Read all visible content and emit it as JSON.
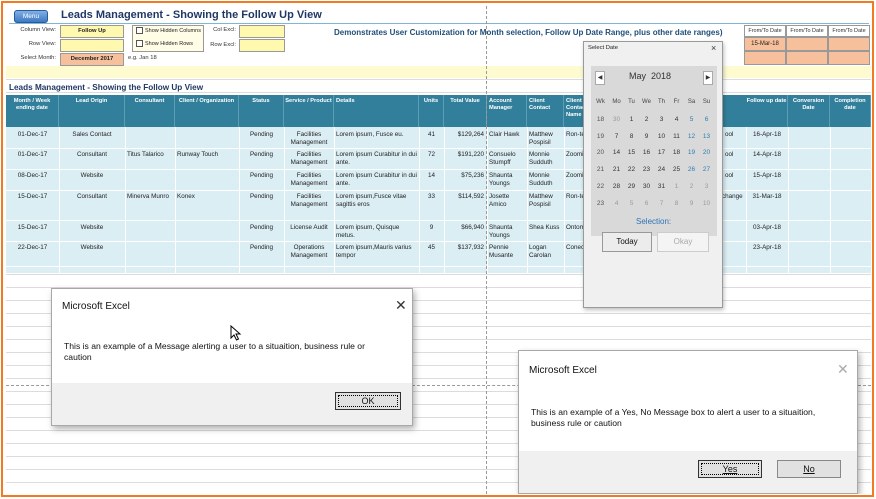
{
  "header": {
    "menu_label": "Menu",
    "title": "Leads Management - Showing the Follow Up View",
    "demo_text": "Demonstrates User Customization for Month selection, Follow Up Date Range, plus other date ranges)"
  },
  "controls": {
    "column_view_label": "Column View:",
    "column_view_value": "Follow Up",
    "row_view_label": "Row View:",
    "row_view_value": "",
    "select_month_label": "Select Month:",
    "select_month_value": "December 2017",
    "month_hint": "e.g. Jan 18",
    "show_hidden_columns": "Show Hidden Columns",
    "show_hidden_rows": "Show Hidden Rows",
    "col_excl_label": "Col Excl:",
    "row_excl_label": "Row Excl:"
  },
  "from_to": {
    "headers": [
      "From/To Date",
      "From/To Date",
      "From/To Date"
    ],
    "first_value": "15-Mar-18"
  },
  "subtitle": "Leads Management - Showing the Follow Up View",
  "table": {
    "columns": [
      "Month / Week ending date",
      "Lead Origin",
      "Consultant",
      "Client / Organization",
      "Status",
      "Service / Product",
      "Details",
      "Units",
      "Total Value",
      "Account Manager",
      "Client Contact",
      "Client Contact Name",
      "Follow up date",
      "Conversion Date",
      "Completion date"
    ],
    "rows": [
      {
        "date": "01-Dec-17",
        "origin": "Sales Contact",
        "consultant": "",
        "client": "",
        "status": "Pending",
        "service": "Facilities Management",
        "details": "Lorem ipsum, Fusce eu.",
        "units": "41",
        "value": "$129,264",
        "am": "Clair Hawk",
        "contact": "Matthew Pospisil",
        "name": "Ron-te",
        "tail": "ool",
        "follow": "16-Apr-18"
      },
      {
        "date": "01-Dec-17",
        "origin": "Consultant",
        "consultant": "Titus Talarico",
        "client": "Runway Touch",
        "status": "Pending",
        "service": "Facilities Management",
        "details": "Lorem ipsum Curabitur in dui ante.",
        "units": "72",
        "value": "$191,220",
        "am": "Consuelo Stumpff",
        "contact": "Monnie Sudduth",
        "name": "Zoomi",
        "tail": "ool",
        "follow": "14-Apr-18"
      },
      {
        "date": "08-Dec-17",
        "origin": "Website",
        "consultant": "",
        "client": "",
        "status": "Pending",
        "service": "Facilities Management",
        "details": "Lorem ipsum Curabitur in dui ante.",
        "units": "14",
        "value": "$75,236",
        "am": "Shaunta Youngs",
        "contact": "Monnie Sudduth",
        "name": "Zoomi",
        "tail": "ool",
        "follow": "15-Apr-18"
      },
      {
        "date": "15-Dec-17",
        "origin": "Consultant",
        "consultant": "Minerva Munro",
        "client": "Konex",
        "status": "Pending",
        "service": "Facilities Management",
        "details": "Lorem ipsum,Fusce vitae sagittis eros",
        "units": "33",
        "value": "$114,592",
        "am": "Josette Amico",
        "contact": "Matthew Pospisil",
        "name": "Ron-te",
        "tail": "change",
        "follow": "31-Mar-18"
      },
      {
        "date": "15-Dec-17",
        "origin": "Website",
        "consultant": "",
        "client": "",
        "status": "Pending",
        "service": "License Audit",
        "details": "Lorem ipsum, Quisque metus.",
        "units": "9",
        "value": "$66,940",
        "am": "Shaunta Youngs",
        "contact": "Shea Kuss",
        "name": "Ontom",
        "tail": "",
        "follow": "03-Apr-18"
      },
      {
        "date": "22-Dec-17",
        "origin": "Website",
        "consultant": "",
        "client": "",
        "status": "Pending",
        "service": "Operations Management",
        "details": "Lorem ipsum,Mauris varius tempor",
        "units": "45",
        "value": "$137,932",
        "am": "Pennie Musante",
        "contact": "Logan Carolan",
        "name": "Conec",
        "tail": "",
        "follow": "23-Apr-18"
      }
    ]
  },
  "date_picker": {
    "title": "Select Date",
    "close": "×",
    "month": "May",
    "year": "2018",
    "prev": "◀",
    "next": "▶",
    "weekday_headers": [
      "Wk",
      "Mo",
      "Tu",
      "We",
      "Th",
      "Fr",
      "Sa",
      "Su"
    ],
    "weeks": [
      [
        "18",
        "30",
        "1",
        "2",
        "3",
        "4",
        "5",
        "6"
      ],
      [
        "19",
        "7",
        "8",
        "9",
        "10",
        "11",
        "12",
        "13"
      ],
      [
        "20",
        "14",
        "15",
        "16",
        "17",
        "18",
        "19",
        "20"
      ],
      [
        "21",
        "21",
        "22",
        "23",
        "24",
        "25",
        "26",
        "27"
      ],
      [
        "22",
        "28",
        "29",
        "30",
        "31",
        "1",
        "2",
        "3"
      ],
      [
        "23",
        "4",
        "5",
        "6",
        "7",
        "8",
        "9",
        "10"
      ]
    ],
    "selection_label": "Selection:",
    "today_label": "Today",
    "okay_label": "Okay"
  },
  "dialog1": {
    "title": "Microsoft Excel",
    "close": "✕",
    "message": "This is an example of a Message  alerting a user to a situaition, business rule or caution",
    "ok_label": "OK"
  },
  "dialog2": {
    "title": "Microsoft Excel",
    "close": "✕",
    "message": "This is an example of a Yes, No Message box to alert a user to a situaition, business rule or caution",
    "yes_label": "Yes",
    "no_label": "No"
  },
  "colors": {
    "frame": "#f07b22",
    "header_teal": "#317f9a",
    "row_bg": "#dbeef4",
    "accent_orange": "#f7c09c",
    "accent_yellow": "#fff9b0"
  }
}
